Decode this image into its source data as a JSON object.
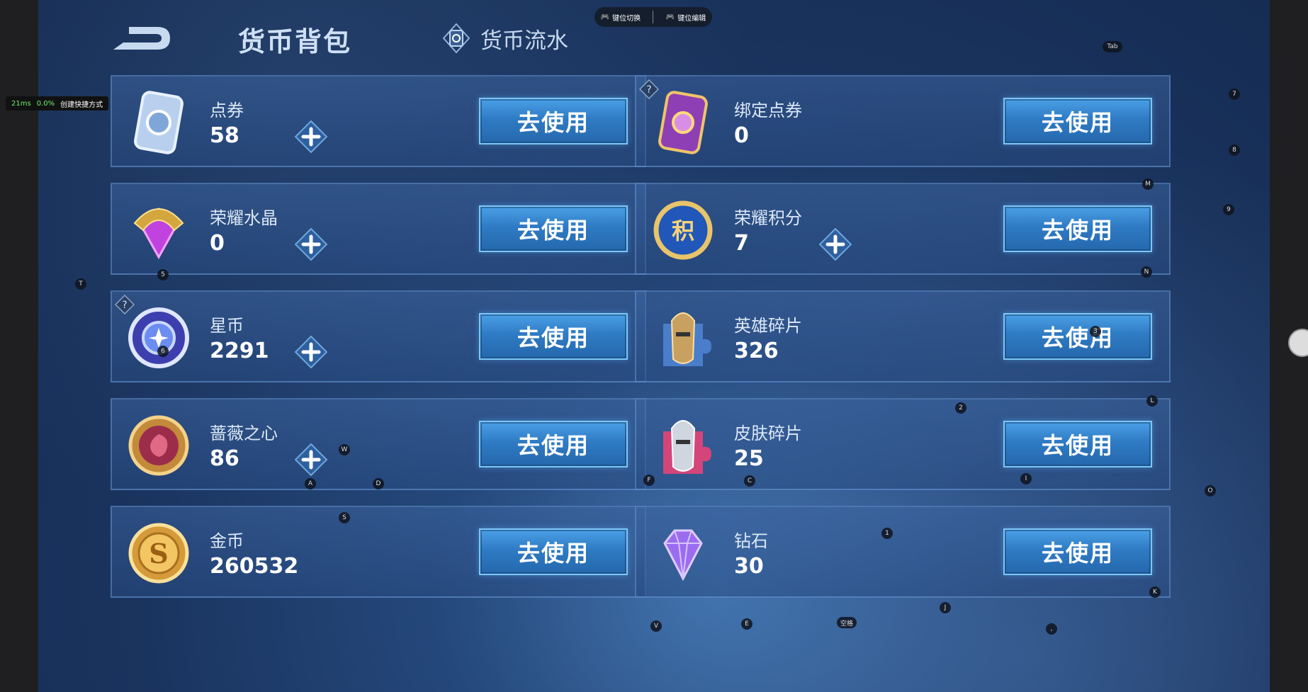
{
  "header": {
    "title": "货币背包",
    "tab_flow": "货币流水"
  },
  "topbar": {
    "switch_label": "键位切换",
    "edit_label": "键位编辑"
  },
  "perf": {
    "latency": "21ms",
    "percent": "0.0%",
    "shortcut": "创建快捷方式"
  },
  "use_label": "去使用",
  "currencies": [
    {
      "name": "点券",
      "value": "58",
      "plus": true,
      "icon": "coupon-icon"
    },
    {
      "name": "绑定点券",
      "value": "0",
      "plus": false,
      "icon": "bound-coupon-icon"
    },
    {
      "name": "荣耀水晶",
      "value": "0",
      "plus": true,
      "icon": "glory-crystal-icon"
    },
    {
      "name": "荣耀积分",
      "value": "7",
      "plus": true,
      "icon": "glory-points-icon"
    },
    {
      "name": "星币",
      "value": "2291",
      "plus": true,
      "icon": "star-coin-icon"
    },
    {
      "name": "英雄碎片",
      "value": "326",
      "plus": false,
      "icon": "hero-shard-icon"
    },
    {
      "name": "蔷薇之心",
      "value": "86",
      "plus": true,
      "icon": "rose-heart-icon"
    },
    {
      "name": "皮肤碎片",
      "value": "25",
      "plus": false,
      "icon": "skin-shard-icon"
    },
    {
      "name": "金币",
      "value": "260532",
      "plus": false,
      "icon": "gold-coin-icon"
    },
    {
      "name": "钻石",
      "value": "30",
      "plus": false,
      "icon": "diamond-icon"
    }
  ],
  "key_hints": [
    "Tab",
    "7",
    "8",
    "M",
    "9",
    "N",
    "T",
    "5",
    "6",
    "3",
    "2",
    "L",
    "W",
    "A",
    "D",
    "F",
    "C",
    "I",
    "O",
    "S",
    "1",
    "K",
    "J",
    "V",
    "E",
    "空格",
    ","
  ]
}
